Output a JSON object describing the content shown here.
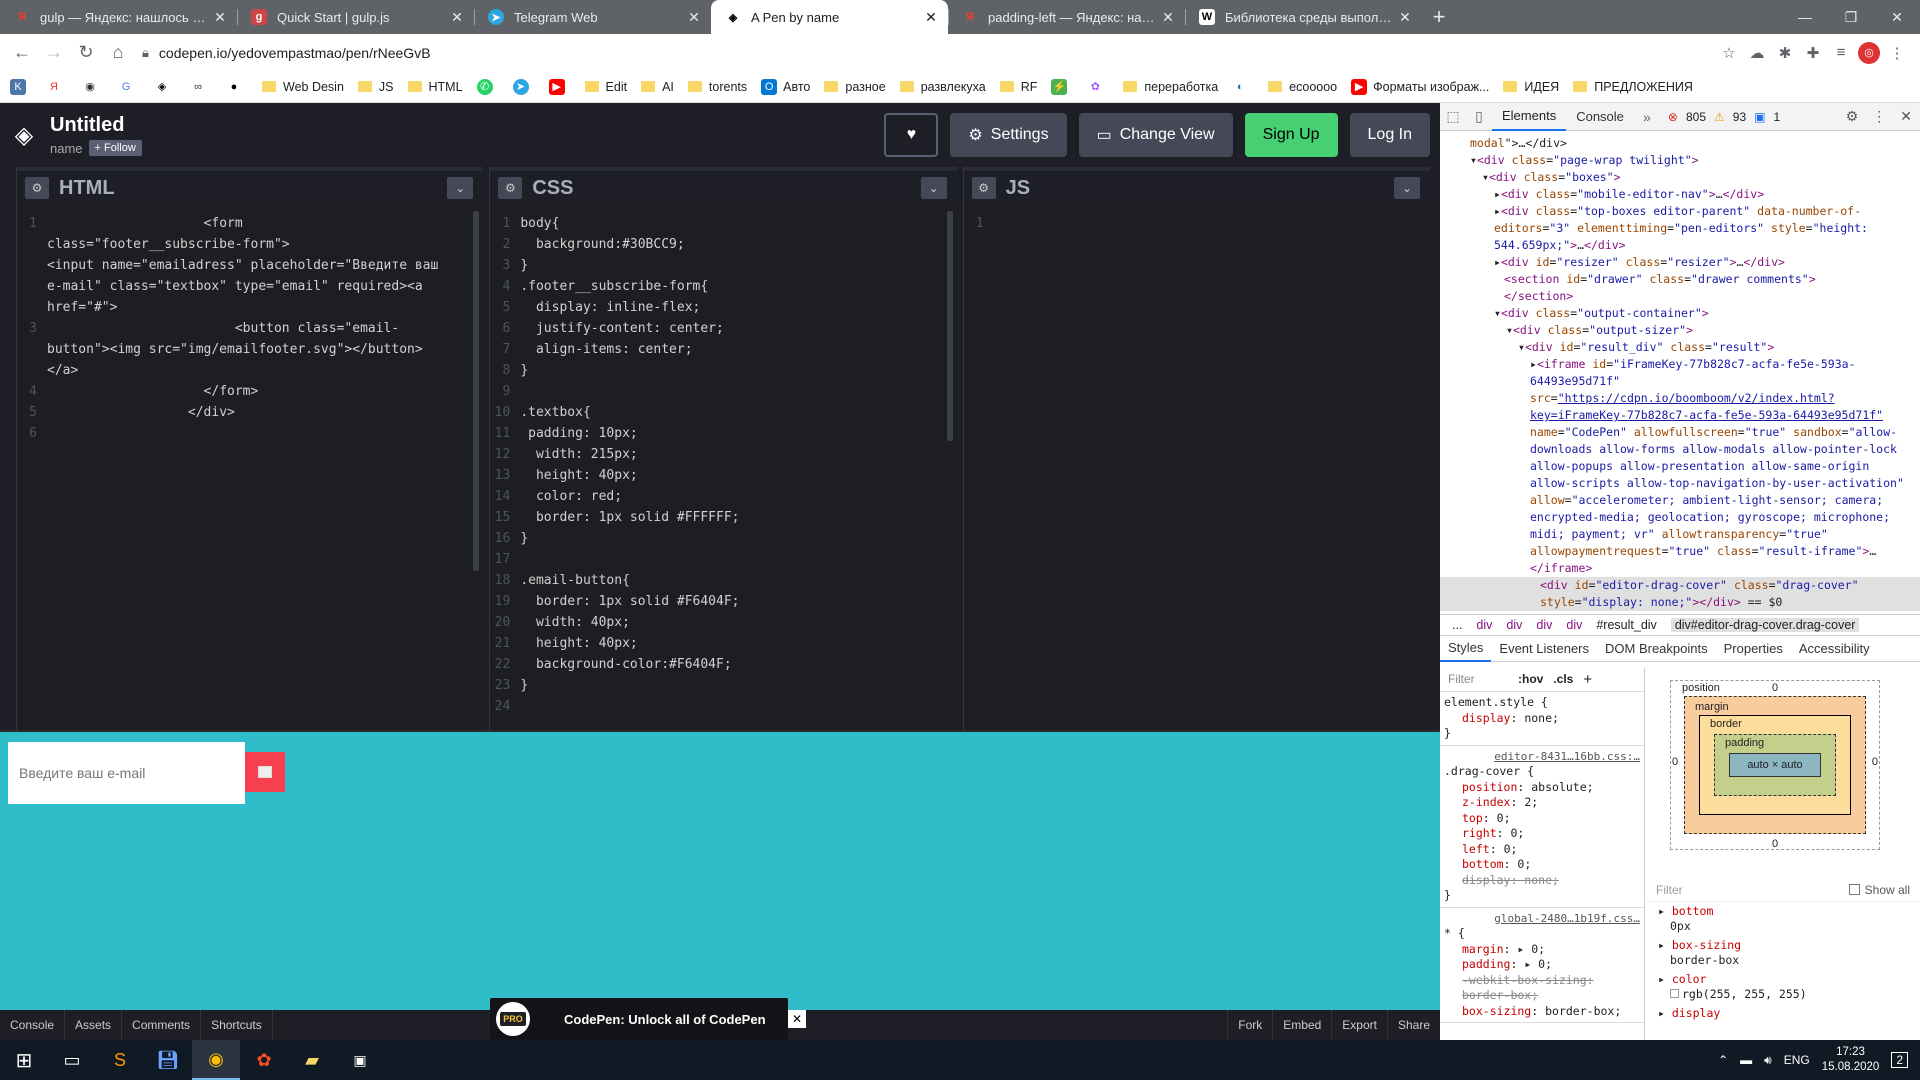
{
  "browser": {
    "tabs": [
      {
        "icon": "yandex-icon",
        "title": "gulp — Яндекс: нашлось 2 млн",
        "active": false
      },
      {
        "icon": "gulp-icon",
        "title": "Quick Start | gulp.js",
        "active": false
      },
      {
        "icon": "telegram-icon",
        "title": "Telegram Web",
        "active": false
      },
      {
        "icon": "codepen-icon",
        "title": "A Pen by name",
        "active": true
      },
      {
        "icon": "yandex-icon",
        "title": "padding-left — Яндекс: нашлось",
        "active": false
      },
      {
        "icon": "w-icon",
        "title": "Библиотека среды выполнения",
        "active": false
      }
    ],
    "url": "codepen.io/yedovempastmao/pen/rNeeGvB",
    "bookmarks": [
      "Web Desin",
      "JS",
      "HTML",
      "Edit",
      "AI",
      "torents",
      "Авто",
      "разное",
      "развлекуха",
      "RF",
      "переработка",
      "ecooooo",
      "Форматы изображ...",
      "ИДЕЯ",
      "ПРЕДЛОЖЕНИЯ"
    ]
  },
  "codepen": {
    "title": "Untitled",
    "user": "name",
    "follow_label": "+ Follow",
    "settings_label": "Settings",
    "change_view_label": "Change View",
    "signup_label": "Sign Up",
    "login_label": "Log In",
    "html_label": "HTML",
    "css_label": "CSS",
    "js_label": "JS",
    "html_lines": [
      {
        "n": "1",
        "t": "                    <form\nclass=\"footer__subscribe-form\">\n<input name=\"emailadress\" placeholder=\"Введите ваш\ne-mail\" class=\"textbox\" type=\"email\" required><a\nhref=\"#\">"
      },
      {
        "n": "3",
        "t": "                        <button class=\"email-\nbutton\"><img src=\"img/emailfooter.svg\"></button>\n</a>"
      },
      {
        "n": "4",
        "t": "                    </form>"
      },
      {
        "n": "5",
        "t": "                  </div>"
      },
      {
        "n": "6",
        "t": ""
      }
    ],
    "css_lines": [
      {
        "n": "1",
        "t": "body{"
      },
      {
        "n": "2",
        "t": "  background:#30BCC9;"
      },
      {
        "n": "3",
        "t": "}"
      },
      {
        "n": "4",
        "t": ".footer__subscribe-form{"
      },
      {
        "n": "5",
        "t": "  display: inline-flex;"
      },
      {
        "n": "6",
        "t": "  justify-content: center;"
      },
      {
        "n": "7",
        "t": "  align-items: center;"
      },
      {
        "n": "8",
        "t": "}"
      },
      {
        "n": "9",
        "t": ""
      },
      {
        "n": "10",
        "t": ".textbox{"
      },
      {
        "n": "11",
        "t": " padding: 10px;"
      },
      {
        "n": "12",
        "t": "  width: 215px;"
      },
      {
        "n": "13",
        "t": "  height: 40px;"
      },
      {
        "n": "14",
        "t": "  color: red;"
      },
      {
        "n": "15",
        "t": "  border: 1px solid #FFFFFF;"
      },
      {
        "n": "16",
        "t": "}"
      },
      {
        "n": "17",
        "t": ""
      },
      {
        "n": "18",
        "t": ".email-button{"
      },
      {
        "n": "19",
        "t": "  border: 1px solid #F6404F;"
      },
      {
        "n": "20",
        "t": "  width: 40px;"
      },
      {
        "n": "21",
        "t": "  height: 40px;"
      },
      {
        "n": "22",
        "t": "  background-color:#F6404F;"
      },
      {
        "n": "23",
        "t": "}"
      },
      {
        "n": "24",
        "t": ""
      }
    ],
    "js_lines": [
      {
        "n": "1",
        "t": ""
      }
    ],
    "preview_placeholder": "Введите ваш e-mail",
    "footer_left": [
      "Console",
      "Assets",
      "Comments",
      "Shortcuts"
    ],
    "footer_right": [
      "Fork",
      "Embed",
      "Export",
      "Share"
    ],
    "pro_badge": "PRO",
    "pro_text": "CodePen: Unlock all of CodePen"
  },
  "devtools": {
    "tabs": [
      "Elements",
      "Console"
    ],
    "errors": "805",
    "warnings": "93",
    "infos": "1",
    "breadcrumbs": [
      "...",
      "div",
      "div",
      "div",
      "div",
      "#result_div",
      "div#editor-drag-cover.drag-cover"
    ],
    "subtabs": [
      "Styles",
      "Event Listeners",
      "DOM Breakpoints",
      "Properties",
      "Accessibility"
    ],
    "filter_placeholder": "Filter",
    "hov_label": ":hov",
    "cls_label": ".cls",
    "show_all_label": "Show all",
    "box_position": "position",
    "box_margin": "margin",
    "box_border": "border",
    "box_padding": "padding",
    "box_content": "auto × auto",
    "computed": [
      {
        "name": "bottom",
        "value": "0px"
      },
      {
        "name": "box-sizing",
        "value": "border-box"
      },
      {
        "name": "color",
        "value": "rgb(255, 255, 255)"
      },
      {
        "name": "display",
        "value": ""
      }
    ]
  },
  "taskbar": {
    "lang": "ENG",
    "time": "17:23",
    "date": "15.08.2020",
    "notif": "2"
  }
}
